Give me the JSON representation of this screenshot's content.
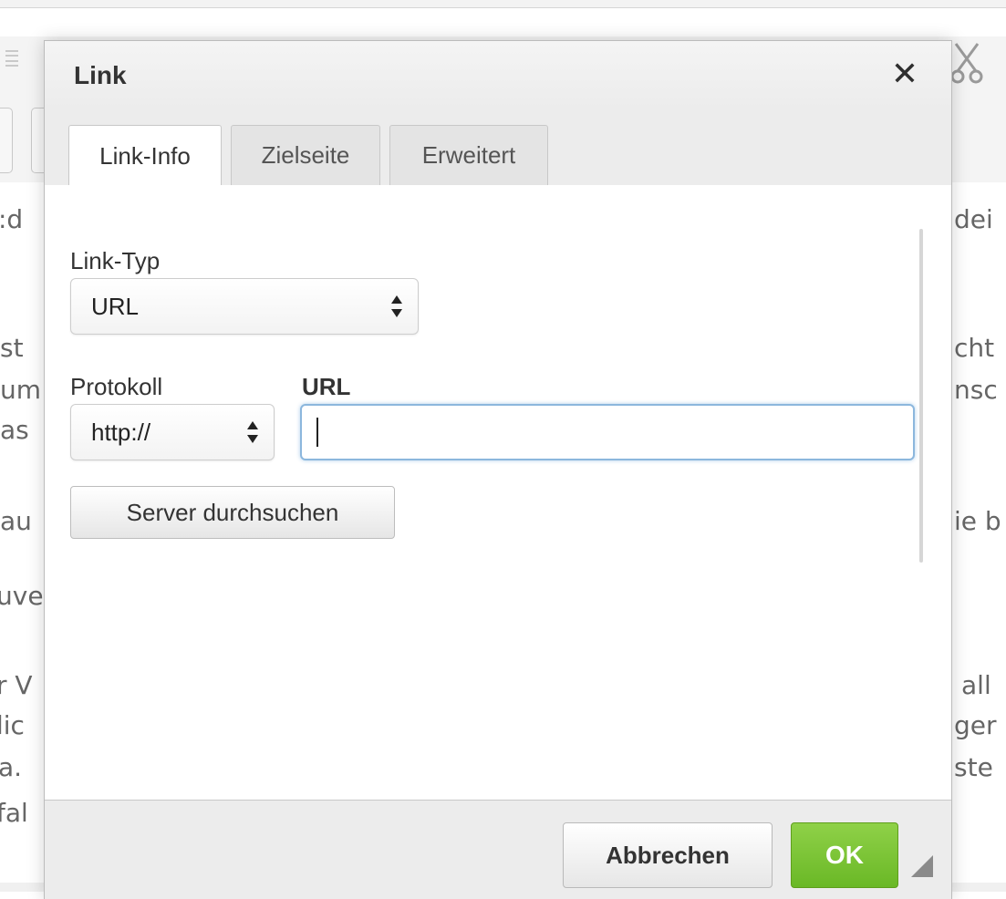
{
  "background": {
    "text_fragments_left": [
      ":d",
      "st",
      "um",
      "as",
      "au",
      "uve",
      "r V",
      "lic",
      "a.",
      "fal"
    ],
    "text_fragments_right": [
      "dei",
      "cht",
      "nsc",
      "ie b",
      "all",
      "ger",
      "ste"
    ]
  },
  "dialog": {
    "title": "Link",
    "close_symbol": "✕",
    "tabs": [
      {
        "label": "Link-Info",
        "active": true
      },
      {
        "label": "Zielseite",
        "active": false
      },
      {
        "label": "Erweitert",
        "active": false
      }
    ],
    "link_type": {
      "label": "Link-Typ",
      "selected": "URL"
    },
    "protocol": {
      "label": "Protokoll",
      "selected": "http://"
    },
    "url": {
      "label": "URL",
      "value": ""
    },
    "browse_button": "Server durchsuchen",
    "footer": {
      "cancel": "Abbrechen",
      "ok": "OK"
    }
  },
  "colors": {
    "ok_green": "#6ab826",
    "focus_blue": "#8cb7dd"
  }
}
